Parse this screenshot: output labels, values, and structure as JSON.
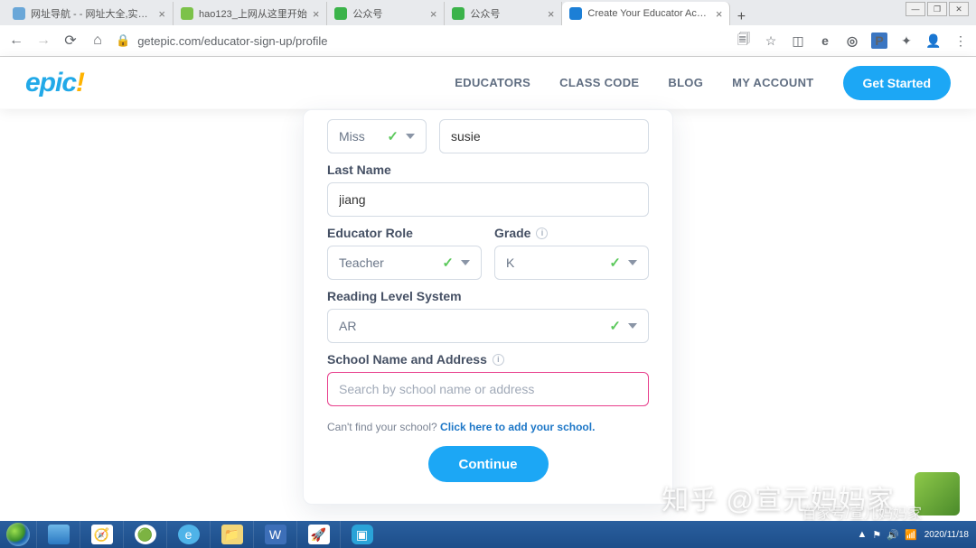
{
  "browser": {
    "tabs": [
      {
        "title": "网址导航 - - 网址大全,实用网址",
        "favicon": "#6aa7d8"
      },
      {
        "title": "hao123_上网从这里开始",
        "favicon": "#7cc24a"
      },
      {
        "title": "公众号",
        "favicon": "#3bb34a"
      },
      {
        "title": "公众号",
        "favicon": "#3bb34a"
      },
      {
        "title": "Create Your Educator Account",
        "favicon": "#1c7fd6",
        "active": true
      }
    ],
    "url": "getepic.com/educator-sign-up/profile",
    "win": {
      "min": "—",
      "max": "❐",
      "close": "✕"
    }
  },
  "nav": {
    "educators": "EDUCATORS",
    "classcode": "CLASS CODE",
    "blog": "BLOG",
    "account": "MY ACCOUNT",
    "cta": "Get Started",
    "logo_main": "epic",
    "logo_excl": "!"
  },
  "form": {
    "prefix": {
      "value": "Miss"
    },
    "firstname": {
      "value": "susie"
    },
    "lastname": {
      "label": "Last Name",
      "value": "jiang"
    },
    "role": {
      "label": "Educator Role",
      "value": "Teacher"
    },
    "grade": {
      "label": "Grade",
      "value": "K"
    },
    "rls": {
      "label": "Reading Level System",
      "value": "AR"
    },
    "school": {
      "label": "School Name and Address",
      "placeholder": "Search by school name or address"
    },
    "help": {
      "text": "Can't find your school? ",
      "link": "Click here to add your school."
    },
    "continue": "Continue"
  },
  "taskbar": {
    "time": "",
    "date": "2020/11/18"
  },
  "watermark": {
    "main": "知乎 @宣元妈妈家",
    "sub": "百家号/宣儿妈妈家"
  }
}
